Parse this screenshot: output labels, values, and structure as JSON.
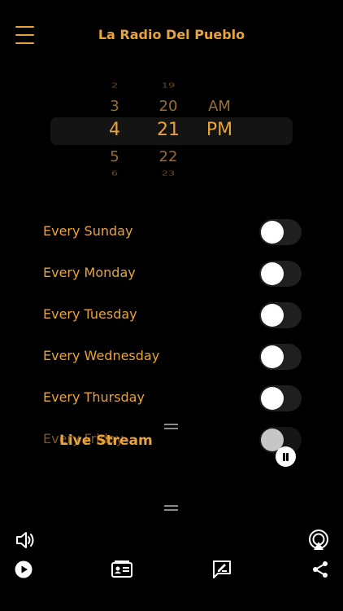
{
  "header": {
    "title": "La Radio Del Pueblo"
  },
  "picker": {
    "hours": [
      "2",
      "3",
      "4",
      "5",
      "6"
    ],
    "minutes": [
      "19",
      "20",
      "21",
      "22",
      "23"
    ],
    "periods": [
      "AM",
      "PM"
    ]
  },
  "alarm_days": [
    {
      "label": "Every Sunday",
      "enabled": false
    },
    {
      "label": "Every Monday",
      "enabled": false
    },
    {
      "label": "Every Tuesday",
      "enabled": false
    },
    {
      "label": "Every Wednesday",
      "enabled": false
    },
    {
      "label": "Every Thursday",
      "enabled": false
    },
    {
      "label": "Every Friday",
      "enabled": false
    }
  ],
  "player": {
    "label": "Live Stream"
  },
  "toolbar": {
    "icons": [
      "volume-icon",
      "airplay-icon",
      "play-icon",
      "contact-card-icon",
      "edit-note-icon",
      "share-icon"
    ]
  },
  "colors": {
    "accent": "#e8a33d",
    "background": "#000000"
  }
}
